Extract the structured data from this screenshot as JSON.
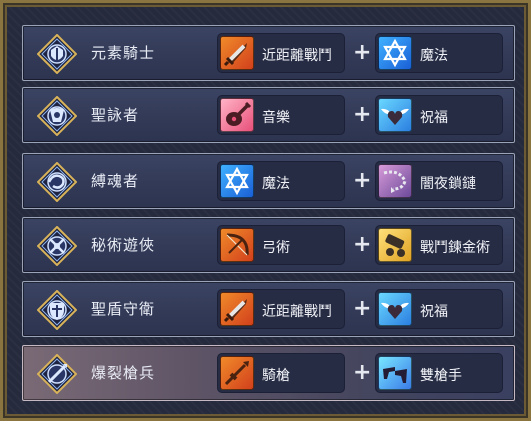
{
  "rows": [
    {
      "class_name": "元素騎士",
      "emblem_icon": "elemental-knight-emblem-icon",
      "skill1": {
        "label": "近距離戰鬥",
        "icon": "sword-icon",
        "color": "#e0561f"
      },
      "skill2": {
        "label": "魔法",
        "icon": "hexagram-icon",
        "color": "#2f86f0"
      }
    },
    {
      "class_name": "聖詠者",
      "emblem_icon": "saint-bard-emblem-icon",
      "skill1": {
        "label": "音樂",
        "icon": "lute-icon",
        "color": "#f07a9a"
      },
      "skill2": {
        "label": "祝福",
        "icon": "winged-heart-icon",
        "color": "#3a9ff0"
      }
    },
    {
      "class_name": "縛魂者",
      "emblem_icon": "soulbinder-emblem-icon",
      "skill1": {
        "label": "魔法",
        "icon": "hexagram-icon",
        "color": "#2f86f0"
      },
      "skill2": {
        "label": "闇夜鎖鏈",
        "icon": "chain-icon",
        "color": "#9b6cb8"
      }
    },
    {
      "class_name": "秘術遊俠",
      "emblem_icon": "arcane-ranger-emblem-icon",
      "skill1": {
        "label": "弓術",
        "icon": "bow-icon",
        "color": "#e0561f"
      },
      "skill2": {
        "label": "戰鬥鍊金術",
        "icon": "cannon-icon",
        "color": "#f2c24a"
      }
    },
    {
      "class_name": "聖盾守衛",
      "emblem_icon": "holy-shield-guardian-emblem-icon",
      "skill1": {
        "label": "近距離戰鬥",
        "icon": "sword-icon",
        "color": "#e0561f"
      },
      "skill2": {
        "label": "祝福",
        "icon": "winged-heart-icon",
        "color": "#3a9ff0"
      }
    },
    {
      "class_name": "爆裂槍兵",
      "emblem_icon": "blast-lancer-emblem-icon",
      "skill1": {
        "label": "騎槍",
        "icon": "lance-icon",
        "color": "#e0561f"
      },
      "skill2": {
        "label": "雙槍手",
        "icon": "dual-pistols-icon",
        "color": "#5aa0f0"
      }
    }
  ],
  "plus_symbol": "+",
  "selected_row": 6
}
